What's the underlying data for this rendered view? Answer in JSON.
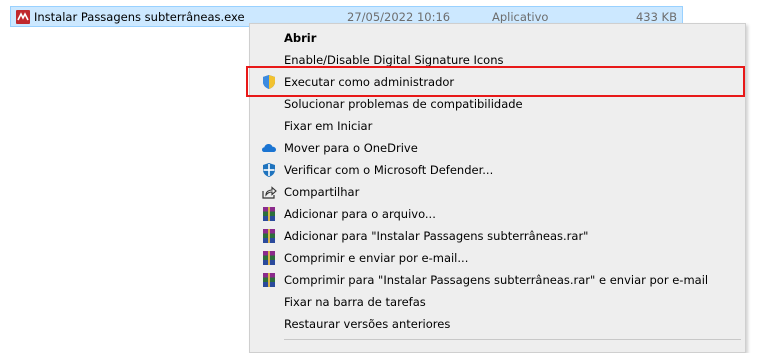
{
  "file": {
    "name": "Instalar Passagens subterrâneas.exe",
    "date": "27/05/2022 10:16",
    "type": "Aplicativo",
    "size": "433 KB",
    "icon": "app-icon"
  },
  "menu": {
    "items": [
      {
        "label": "Abrir",
        "icon": ""
      },
      {
        "label": "Enable/Disable Digital Signature Icons",
        "icon": ""
      },
      {
        "label": "Executar como administrador",
        "icon": "uac-shield-icon"
      },
      {
        "label": "Solucionar problemas de compatibilidade",
        "icon": ""
      },
      {
        "label": "Fixar em Iniciar",
        "icon": ""
      },
      {
        "label": "Mover para o OneDrive",
        "icon": "onedrive-cloud-icon"
      },
      {
        "label": "Verificar com o Microsoft Defender...",
        "icon": "defender-icon"
      },
      {
        "label": "Compartilhar",
        "icon": "share-icon"
      },
      {
        "label": "Adicionar para o arquivo...",
        "icon": "winrar-icon"
      },
      {
        "label": "Adicionar para \"Instalar Passagens subterrâneas.rar\"",
        "icon": "winrar-icon"
      },
      {
        "label": "Comprimir e enviar por e-mail...",
        "icon": "winrar-icon"
      },
      {
        "label": "Comprimir para \"Instalar Passagens subterrâneas.rar\" e enviar por e-mail",
        "icon": "winrar-icon"
      },
      {
        "label": "Fixar na barra de tarefas",
        "icon": ""
      },
      {
        "label": "Restaurar versões anteriores",
        "icon": ""
      }
    ]
  },
  "colors": {
    "selection": "#cce8ff",
    "highlight_border": "#e81818",
    "menu_bg": "#eeeeee"
  }
}
